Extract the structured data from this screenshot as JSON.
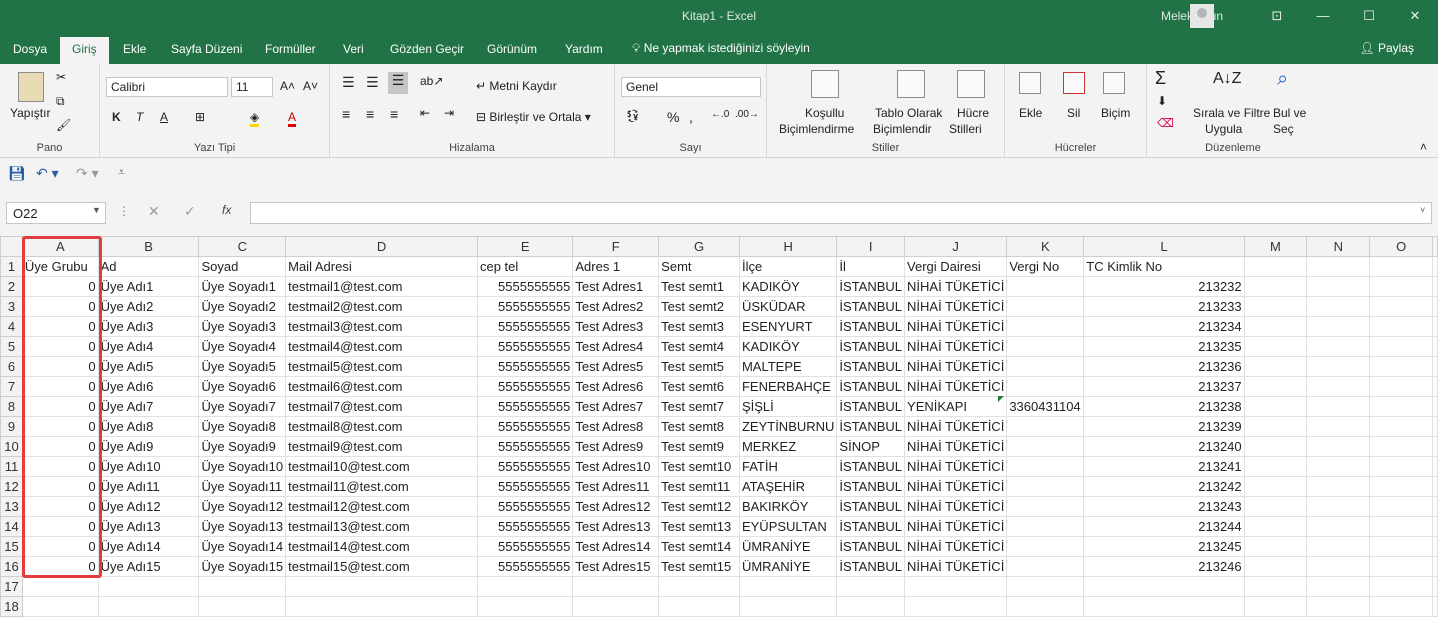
{
  "titlebar": {
    "title": "Kitap1  -  Excel",
    "user": "Melek Altun",
    "ribbon_display": "⊡",
    "minimize": "—",
    "restore": "☐",
    "close": "✕"
  },
  "tabs": [
    "Dosya",
    "Giriş",
    "Ekle",
    "Sayfa Düzeni",
    "Formüller",
    "Veri",
    "Gözden Geçir",
    "Görünüm",
    "Yardım"
  ],
  "active_tab": "Giriş",
  "tell_me": "Ne yapmak istediğinizi söyleyin",
  "share": "Paylaş",
  "ribbon": {
    "pano": {
      "label": "Pano",
      "paste": "Yapıştır"
    },
    "font": {
      "label": "Yazı Tipi",
      "family": "Calibri",
      "size": "11",
      "bold": "K",
      "italic": "T",
      "underline": "A"
    },
    "align": {
      "label": "Hizalama",
      "wrap": "Metni Kaydır",
      "merge": "Birleştir ve Ortala"
    },
    "number": {
      "label": "Sayı",
      "format": "Genel"
    },
    "styles": {
      "label": "Stiller",
      "conditional_1": "Koşullu",
      "conditional_2": "Biçimlendirme",
      "table_1": "Tablo Olarak",
      "table_2": "Biçimlendir",
      "cell_1": "Hücre",
      "cell_2": "Stilleri"
    },
    "cells": {
      "label": "Hücreler",
      "insert": "Ekle",
      "delete": "Sil",
      "format": "Biçim"
    },
    "editing": {
      "label": "Düzenleme",
      "sort_1": "Sırala ve Filtre",
      "sort_2": "Uygula",
      "find_1": "Bul ve",
      "find_2": "Seç"
    }
  },
  "namebox": "O22",
  "fx": "fx",
  "columns": [
    "A",
    "B",
    "C",
    "D",
    "E",
    "F",
    "G",
    "H",
    "I",
    "J",
    "K",
    "L",
    "M",
    "N",
    "O"
  ],
  "rows": [
    [
      "Üye Grubu",
      "Ad",
      "Soyad",
      "Mail Adresi",
      "cep tel",
      "Adres 1",
      "Semt",
      "İlçe",
      "İl",
      "Vergi Dairesi",
      "Vergi No",
      "TC Kimlik No",
      "",
      "",
      ""
    ],
    [
      "0",
      "Üye Adı1",
      "Üye Soyadı1",
      "testmail1@test.com",
      "5555555555",
      "Test Adres1",
      "Test semt1",
      "KADIKÖY",
      "İSTANBUL",
      "NİHAİ TÜKETİCİ",
      "",
      "213232",
      "",
      "",
      ""
    ],
    [
      "0",
      "Üye Adı2",
      "Üye Soyadı2",
      "testmail2@test.com",
      "5555555555",
      "Test Adres2",
      "Test semt2",
      "ÜSKÜDAR",
      "İSTANBUL",
      "NİHAİ TÜKETİCİ",
      "",
      "213233",
      "",
      "",
      ""
    ],
    [
      "0",
      "Üye Adı3",
      "Üye Soyadı3",
      "testmail3@test.com",
      "5555555555",
      "Test Adres3",
      "Test semt3",
      "ESENYURT",
      "İSTANBUL",
      "NİHAİ TÜKETİCİ",
      "",
      "213234",
      "",
      "",
      ""
    ],
    [
      "0",
      "Üye Adı4",
      "Üye Soyadı4",
      "testmail4@test.com",
      "5555555555",
      "Test Adres4",
      "Test semt4",
      "KADIKÖY",
      "İSTANBUL",
      "NİHAİ TÜKETİCİ",
      "",
      "213235",
      "",
      "",
      ""
    ],
    [
      "0",
      "Üye Adı5",
      "Üye Soyadı5",
      "testmail5@test.com",
      "5555555555",
      "Test Adres5",
      "Test semt5",
      "MALTEPE",
      "İSTANBUL",
      "NİHAİ TÜKETİCİ",
      "",
      "213236",
      "",
      "",
      ""
    ],
    [
      "0",
      "Üye Adı6",
      "Üye Soyadı6",
      "testmail6@test.com",
      "5555555555",
      "Test Adres6",
      "Test semt6",
      "FENERBAHÇE",
      "İSTANBUL",
      "NİHAİ TÜKETİCİ",
      "",
      "213237",
      "",
      "",
      ""
    ],
    [
      "0",
      "Üye Adı7",
      "Üye Soyadı7",
      "testmail7@test.com",
      "5555555555",
      "Test Adres7",
      "Test semt7",
      "ŞİŞLİ",
      "İSTANBUL",
      "YENİKAPI",
      "3360431104",
      "213238",
      "",
      "",
      ""
    ],
    [
      "0",
      "Üye Adı8",
      "Üye Soyadı8",
      "testmail8@test.com",
      "5555555555",
      "Test Adres8",
      "Test semt8",
      "ZEYTİNBURNU",
      "İSTANBUL",
      "NİHAİ TÜKETİCİ",
      "",
      "213239",
      "",
      "",
      ""
    ],
    [
      "0",
      "Üye Adı9",
      "Üye Soyadı9",
      "testmail9@test.com",
      "5555555555",
      "Test Adres9",
      "Test semt9",
      "MERKEZ",
      "SİNOP",
      "NİHAİ TÜKETİCİ",
      "",
      "213240",
      "",
      "",
      ""
    ],
    [
      "0",
      "Üye Adı10",
      "Üye Soyadı10",
      "testmail10@test.com",
      "5555555555",
      "Test Adres10",
      "Test semt10",
      "FATİH",
      "İSTANBUL",
      "NİHAİ TÜKETİCİ",
      "",
      "213241",
      "",
      "",
      ""
    ],
    [
      "0",
      "Üye Adı11",
      "Üye Soyadı11",
      "testmail11@test.com",
      "5555555555",
      "Test Adres11",
      "Test semt11",
      "ATAŞEHİR",
      "İSTANBUL",
      "NİHAİ TÜKETİCİ",
      "",
      "213242",
      "",
      "",
      ""
    ],
    [
      "0",
      "Üye Adı12",
      "Üye Soyadı12",
      "testmail12@test.com",
      "5555555555",
      "Test Adres12",
      "Test semt12",
      "BAKIRKÖY",
      "İSTANBUL",
      "NİHAİ TÜKETİCİ",
      "",
      "213243",
      "",
      "",
      ""
    ],
    [
      "0",
      "Üye Adı13",
      "Üye Soyadı13",
      "testmail13@test.com",
      "5555555555",
      "Test Adres13",
      "Test semt13",
      "EYÜPSULTAN",
      "İSTANBUL",
      "NİHAİ TÜKETİCİ",
      "",
      "213244",
      "",
      "",
      ""
    ],
    [
      "0",
      "Üye Adı14",
      "Üye Soyadı14",
      "testmail14@test.com",
      "5555555555",
      "Test Adres14",
      "Test semt14",
      "ÜMRANİYE",
      "İSTANBUL",
      "NİHAİ TÜKETİCİ",
      "",
      "213245",
      "",
      "",
      ""
    ],
    [
      "0",
      "Üye Adı15",
      "Üye Soyadı15",
      "testmail15@test.com",
      "5555555555",
      "Test Adres15",
      "Test semt15",
      "ÜMRANİYE",
      "İSTANBUL",
      "NİHAİ TÜKETİCİ",
      "",
      "213246",
      "",
      "",
      ""
    ],
    [
      "",
      "",
      "",
      "",
      "",
      "",
      "",
      "",
      "",
      "",
      "",
      "",
      "",
      "",
      ""
    ],
    [
      "",
      "",
      "",
      "",
      "",
      "",
      "",
      "",
      "",
      "",
      "",
      "",
      "",
      "",
      ""
    ]
  ],
  "numeric_columns": [
    0,
    4,
    11
  ],
  "colors": {
    "excel_green": "#217346",
    "highlight": "#e23c3c"
  }
}
